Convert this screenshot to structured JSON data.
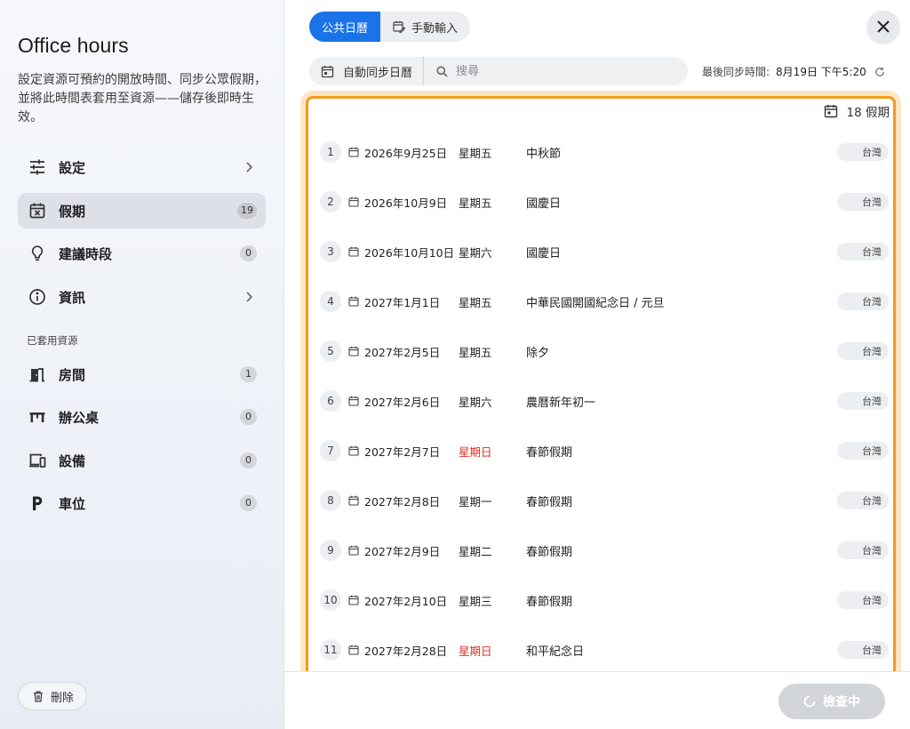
{
  "sidebar": {
    "title": "Office hours",
    "description": "設定資源可預約的開放時間、同步公眾假期，並將此時間表套用至資源——儲存後即時生效。",
    "nav": [
      {
        "label": "設定",
        "icon": "sliders-icon"
      },
      {
        "label": "假期",
        "icon": "calendar-x-icon",
        "badge": "19",
        "active": true
      },
      {
        "label": "建議時段",
        "icon": "lightbulb-icon",
        "badge": "0"
      },
      {
        "label": "資訊",
        "icon": "info-icon"
      }
    ],
    "resources_heading": "已套用資源",
    "resources": [
      {
        "label": "房間",
        "icon": "door-icon",
        "badge": "1"
      },
      {
        "label": "辦公桌",
        "icon": "desk-icon",
        "badge": "0"
      },
      {
        "label": "設備",
        "icon": "devices-icon",
        "badge": "0"
      },
      {
        "label": "車位",
        "icon": "parking-icon",
        "badge": "0"
      }
    ],
    "delete_label": "刪除"
  },
  "tabs": [
    {
      "label": "公共日曆",
      "active": true
    },
    {
      "label": "手動輸入",
      "icon": "calendar-edit-icon"
    }
  ],
  "toolbar": {
    "sync_label": "自動同步日曆",
    "search_placeholder": "搜尋",
    "last_sync_label": "最後同步時間:",
    "last_sync_value": "8月19日 下午5:20"
  },
  "holiday_count_label": "18 假期",
  "holidays": [
    {
      "num": "1",
      "date": "2026年9月25日",
      "weekday": "星期五",
      "name": "中秋節",
      "region": "台灣"
    },
    {
      "num": "2",
      "date": "2026年10月9日",
      "weekday": "星期五",
      "name": "國慶日",
      "region": "台灣"
    },
    {
      "num": "3",
      "date": "2026年10月10日",
      "weekday": "星期六",
      "name": "國慶日",
      "region": "台灣"
    },
    {
      "num": "4",
      "date": "2027年1月1日",
      "weekday": "星期五",
      "name": "中華民國開國紀念日 / 元旦",
      "region": "台灣"
    },
    {
      "num": "5",
      "date": "2027年2月5日",
      "weekday": "星期五",
      "name": "除夕",
      "region": "台灣"
    },
    {
      "num": "6",
      "date": "2027年2月6日",
      "weekday": "星期六",
      "name": "農曆新年初一",
      "region": "台灣"
    },
    {
      "num": "7",
      "date": "2027年2月7日",
      "weekday": "星期日",
      "name": "春節假期",
      "region": "台灣",
      "sunday": true
    },
    {
      "num": "8",
      "date": "2027年2月8日",
      "weekday": "星期一",
      "name": "春節假期",
      "region": "台灣"
    },
    {
      "num": "9",
      "date": "2027年2月9日",
      "weekday": "星期二",
      "name": "春節假期",
      "region": "台灣"
    },
    {
      "num": "10",
      "date": "2027年2月10日",
      "weekday": "星期三",
      "name": "春節假期",
      "region": "台灣"
    },
    {
      "num": "11",
      "date": "2027年2月28日",
      "weekday": "星期日",
      "name": "和平紀念日",
      "region": "台灣",
      "sunday": true
    }
  ],
  "footer": {
    "check_label": "檢查中"
  },
  "colors": {
    "accent": "#1a73e8",
    "highlight": "#f29a1d",
    "sunday": "#d93025"
  }
}
